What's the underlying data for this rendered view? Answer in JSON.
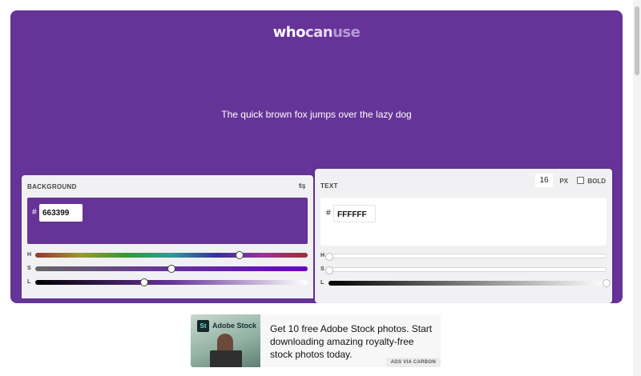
{
  "logo": {
    "part1": "who",
    "part2": "can",
    "part3": "use"
  },
  "sample_text": "The quick brown fox jumps over the lazy dog",
  "background_panel": {
    "title": "BACKGROUND",
    "swap_icon": "swap-icon",
    "hash": "#",
    "hex": "663399",
    "color": "#663399",
    "sliders": [
      {
        "label": "H",
        "value": 270,
        "max": 360
      },
      {
        "label": "S",
        "value": 50,
        "max": 100
      },
      {
        "label": "L",
        "value": 40,
        "max": 100
      }
    ]
  },
  "text_panel": {
    "title": "TEXT",
    "font_size": "16",
    "unit": "PX",
    "bold_label": "BOLD",
    "bold_checked": false,
    "hash": "#",
    "hex": "FFFFFF",
    "color": "#FFFFFF",
    "sliders": [
      {
        "label": "H",
        "value": 0,
        "max": 360
      },
      {
        "label": "S",
        "value": 0,
        "max": 100
      },
      {
        "label": "L",
        "value": 100,
        "max": 100
      }
    ]
  },
  "ad": {
    "brand": "Adobe Stock",
    "logo_text": "St",
    "text": "Get 10 free Adobe Stock photos. Start downloading amazing royalty-free stock photos today.",
    "via": "ADS VIA CARBON"
  },
  "colors": {
    "hero_bg": "#663399",
    "panel_bg": "#f1f1f3"
  }
}
